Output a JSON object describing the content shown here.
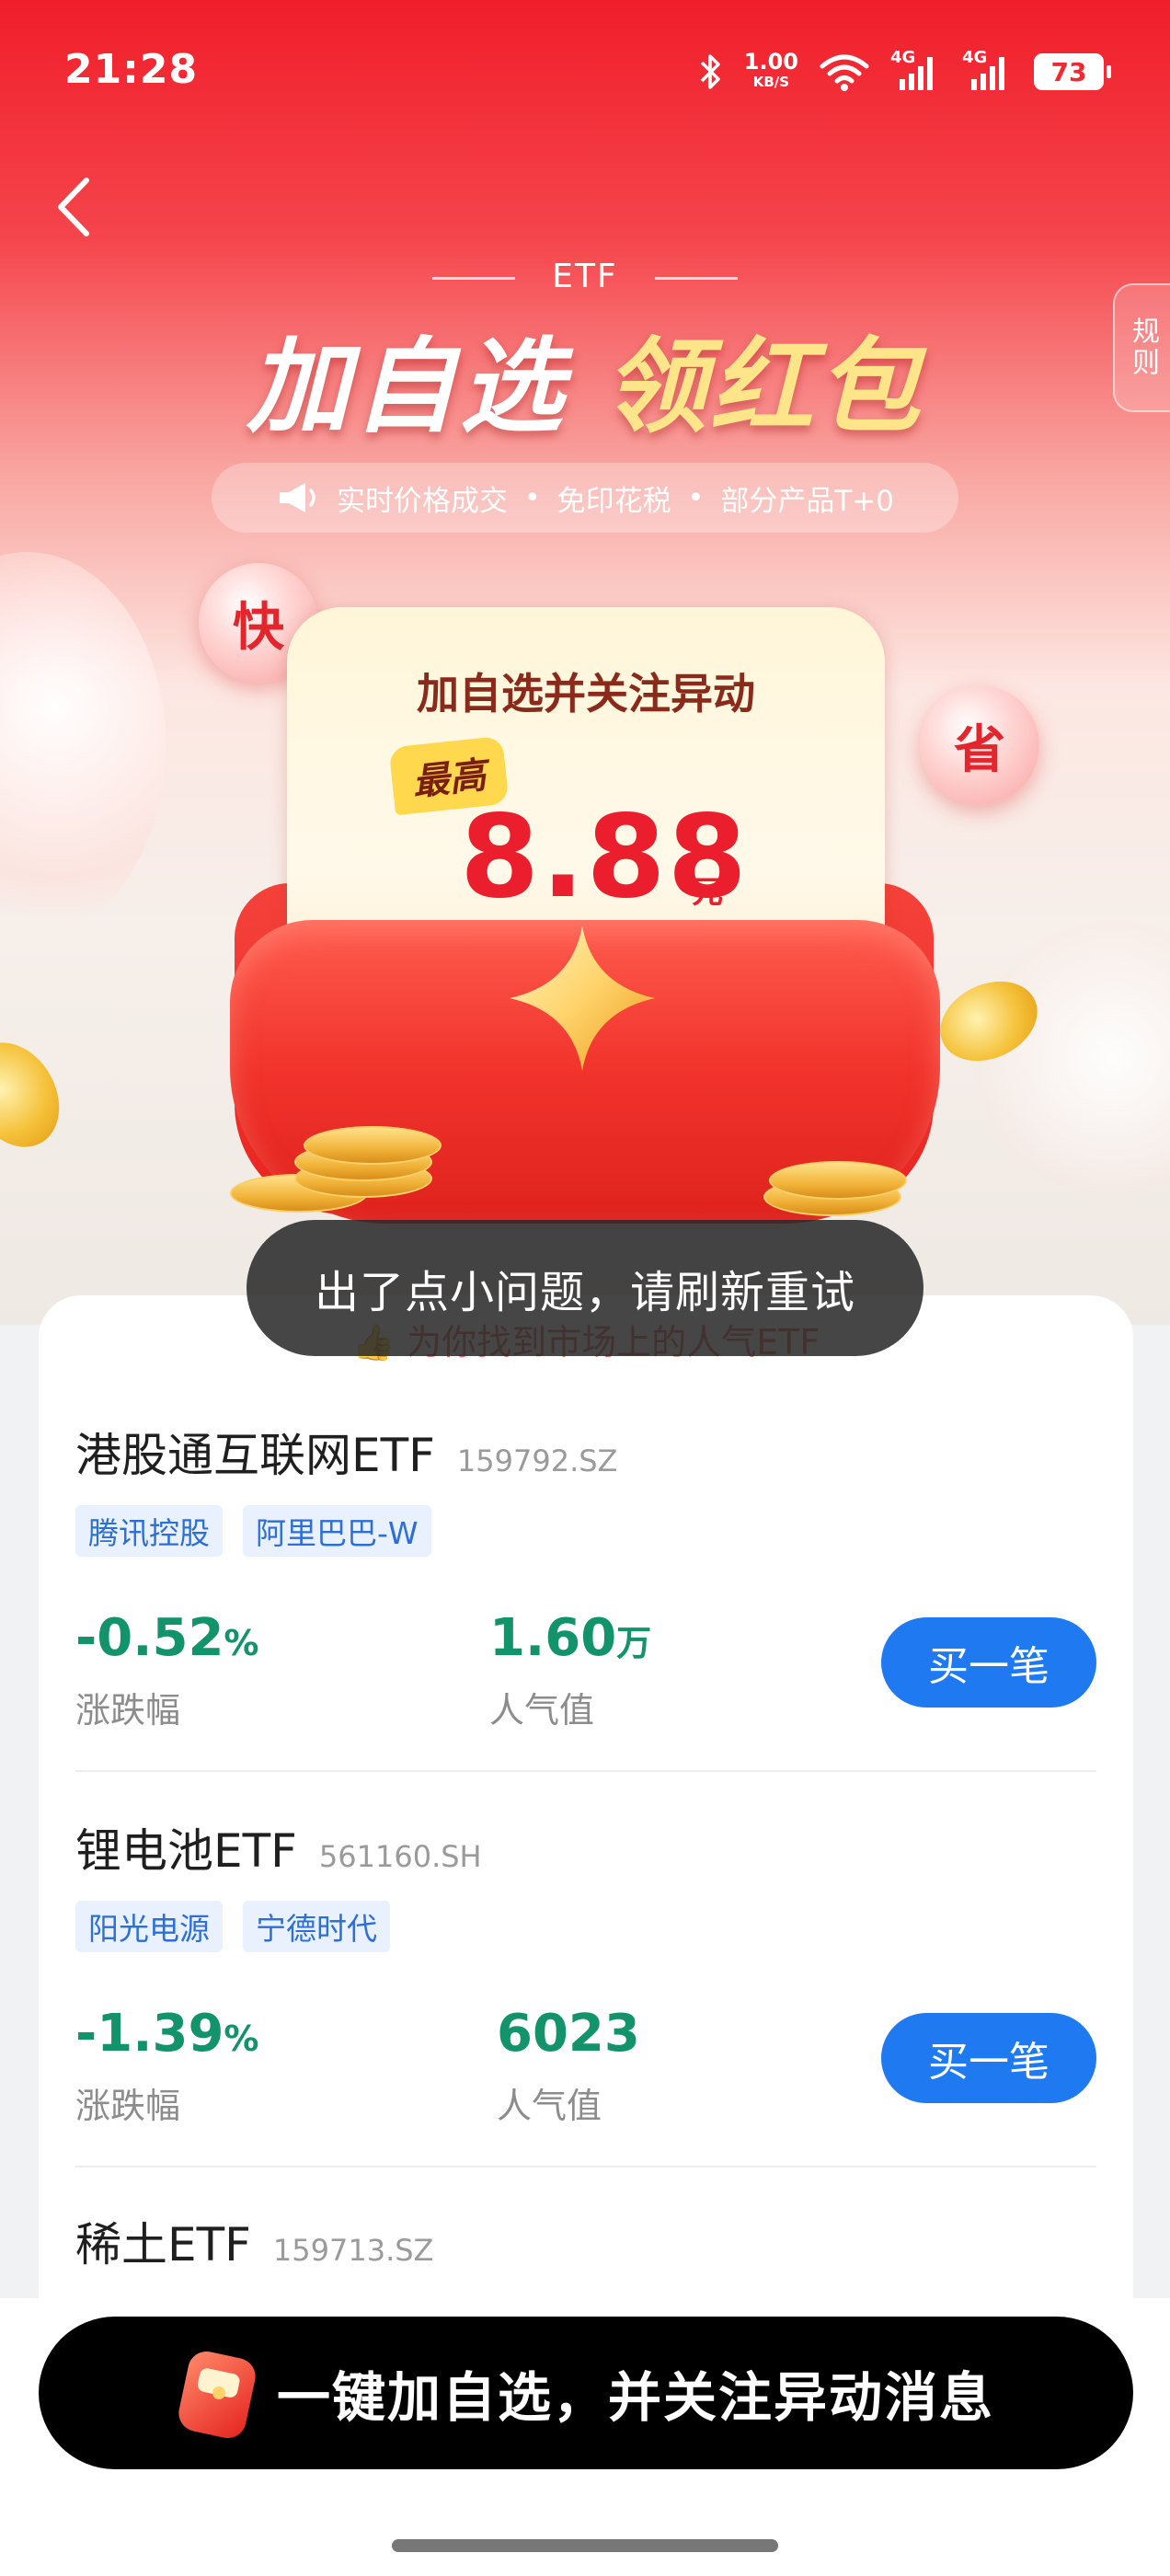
{
  "status_bar": {
    "time": "21:28",
    "net_speed": "1.00",
    "net_unit": "KB/S",
    "signal_1": "4G",
    "signal_2": "4G",
    "battery": "73"
  },
  "header": {
    "etf_tag": "ETF",
    "headline_part1": "加自选",
    "headline_part2": "领红包",
    "rules_label": "规则",
    "features": [
      "实时价格成交",
      "免印花税",
      "部分产品T+0"
    ]
  },
  "decor": {
    "bubble_left": "快",
    "bubble_right": "省"
  },
  "promo_card": {
    "title": "加自选并关注异动",
    "badge": "最高",
    "amount": "8.88",
    "unit": "元"
  },
  "toast": {
    "message": "出了点小问题，请刷新重试"
  },
  "list": {
    "caption": "为你找到市场上的人气ETF",
    "items": [
      {
        "name": "港股通互联网ETF",
        "code": "159792.SZ",
        "tags": [
          "腾讯控股",
          "阿里巴巴-W"
        ],
        "change_value": "-0.52",
        "change_unit": "%",
        "change_label": "涨跌幅",
        "popularity_value": "1.60",
        "popularity_unit": "万",
        "popularity_label": "人气值",
        "buy_label": "买一笔"
      },
      {
        "name": "锂电池ETF",
        "code": "561160.SH",
        "tags": [
          "阳光电源",
          "宁德时代"
        ],
        "change_value": "-1.39",
        "change_unit": "%",
        "change_label": "涨跌幅",
        "popularity_value": "6023",
        "popularity_unit": "",
        "popularity_label": "人气值",
        "buy_label": "买一笔"
      },
      {
        "name": "稀土ETF",
        "code": "159713.SZ"
      }
    ]
  },
  "cta": {
    "label": "一键加自选，并关注异动消息"
  },
  "colors": {
    "brand_red": "#f01e2a",
    "down_green": "#12936a",
    "buy_blue": "#1f7af2",
    "tag_blue": "#2d6fd6"
  }
}
